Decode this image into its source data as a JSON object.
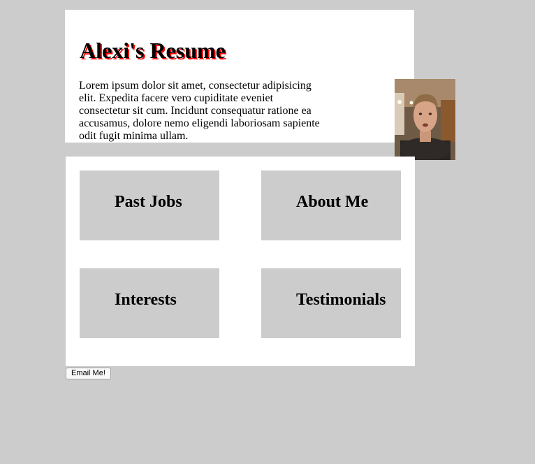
{
  "header": {
    "title": "Alexi's Resume",
    "intro": "Lorem ipsum dolor sit amet, consectetur adipisicing elit. Expedita facere vero cupiditate eveniet consectetur sit cum. Incidunt consequatur ratione ea accusamus, dolore nemo eligendi laboriosam sapiente odit fugit minima ullam."
  },
  "photo": {
    "subject": "portrait-photo"
  },
  "tiles": [
    {
      "label": "Past Jobs"
    },
    {
      "label": "About Me"
    },
    {
      "label": "Interests"
    },
    {
      "label": "Testimonials"
    }
  ],
  "email_button": {
    "label": "Email Me!"
  },
  "colors": {
    "page_background": "#cccccc",
    "panel_background": "#ffffff",
    "tile_background": "#cccccc",
    "title_shadow": "#ff0000"
  }
}
